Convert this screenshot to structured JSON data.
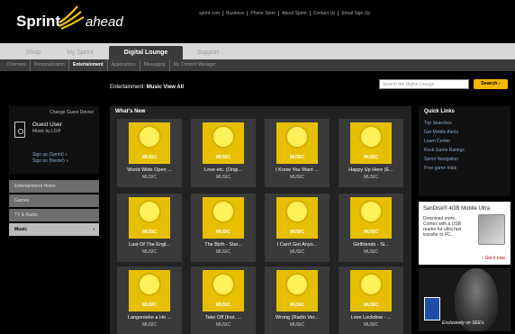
{
  "header": {
    "brand": "Sprint",
    "tagline": "ahead",
    "links": [
      "sprint.com",
      "Business",
      "Phone Store",
      "About Sprint",
      "Contact Us",
      "Email Sign Up"
    ]
  },
  "tabs": [
    {
      "label": "Shop",
      "active": false
    },
    {
      "label": "My Sprint",
      "active": false
    },
    {
      "label": "Digital Lounge",
      "active": true
    },
    {
      "label": "Support",
      "active": false
    }
  ],
  "subnav": [
    {
      "label": "Overview",
      "active": false
    },
    {
      "label": "Personalization",
      "active": false
    },
    {
      "label": "Entertainment",
      "active": true
    },
    {
      "label": "Applications",
      "active": false
    },
    {
      "label": "Messaging",
      "active": false
    },
    {
      "label": "My Content Manager",
      "active": false
    }
  ],
  "breadcrumb": {
    "prefix": "Entertainment:",
    "current": "Music",
    "view_all": "View All"
  },
  "search": {
    "placeholder": "Search the Digital Lounge",
    "button": "Search ›"
  },
  "left_panel": {
    "change_device": "Change Guest Device",
    "user": "Guest User",
    "model": "Music by LG®",
    "sign_up": "Sign up (Sprint) »",
    "sign_on": "Sign on (Nextel) »"
  },
  "categories": [
    {
      "label": "Entertainment Home",
      "selected": false
    },
    {
      "label": "Games",
      "selected": false
    },
    {
      "label": "TV & Radio",
      "selected": false
    },
    {
      "label": "Music",
      "selected": true
    }
  ],
  "main": {
    "heading": "What's New",
    "tiles": [
      {
        "title": "World Wide Open ...",
        "category": "MUSIC",
        "cover_label": "MUSIC"
      },
      {
        "title": "Love etc. (Origi...",
        "category": "MUSIC",
        "cover_label": "MUSIC"
      },
      {
        "title": "I Know You Want ...",
        "category": "MUSIC",
        "cover_label": "MUSIC"
      },
      {
        "title": "Happy Up Here (E...",
        "category": "MUSIC",
        "cover_label": "MUSIC"
      },
      {
        "title": "Last Of The Engl...",
        "category": "MUSIC",
        "cover_label": "MUSIC"
      },
      {
        "title": "The Birth - Star...",
        "category": "MUSIC",
        "cover_label": "MUSIC"
      },
      {
        "title": "I Can't Get Anyo...",
        "category": "MUSIC",
        "cover_label": "MUSIC"
      },
      {
        "title": "Girlfriends - Si...",
        "category": "MUSIC",
        "cover_label": "MUSIC"
      },
      {
        "title": "Langoreeke a Ho ...",
        "category": "MUSIC",
        "cover_label": "MUSIC"
      },
      {
        "title": "Take Off (Inst. ...",
        "category": "MUSIC",
        "cover_label": "MUSIC"
      },
      {
        "title": "Wrong (Radio Ver...",
        "category": "MUSIC",
        "cover_label": "MUSIC"
      },
      {
        "title": "Love Lockdow - ...",
        "category": "MUSIC",
        "cover_label": "MUSIC"
      }
    ]
  },
  "quick_links": {
    "heading": "Quick Links",
    "links": [
      "Top Searches",
      "Get Mobile Alerts",
      "Learn Center",
      "Rock Game Ratings",
      "Sprint Navigation",
      "Free game trials"
    ]
  },
  "ads": {
    "sandisk": {
      "title": "SanDisk® 4GB Mobile Ultra",
      "body": "Download more. Comes with a USB reader for ultra fast transfer to PC.",
      "link": "› Get it now"
    },
    "fifty_cent": {
      "tagline": "Exclusively on SEE's"
    }
  }
}
